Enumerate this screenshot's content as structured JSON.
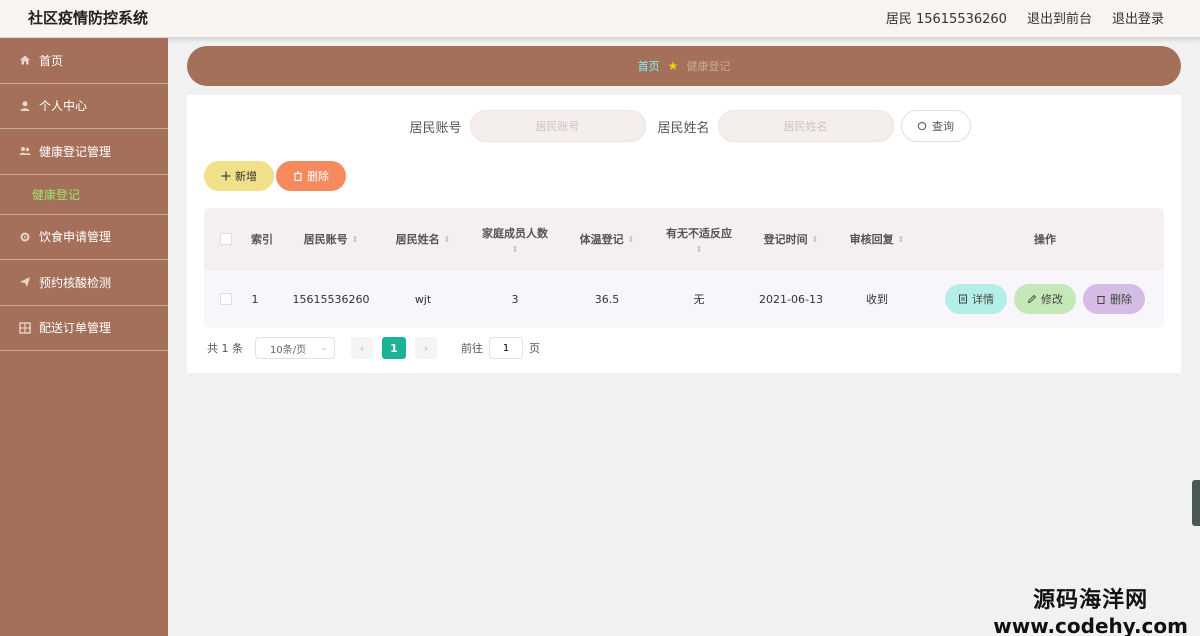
{
  "header": {
    "app_title": "社区疫情防控系统",
    "user": "居民 15615536260",
    "to_front": "退出到前台",
    "logout": "退出登录"
  },
  "sidebar": {
    "items": [
      {
        "label": "首页",
        "icon": "home-icon"
      },
      {
        "label": "个人中心",
        "icon": "user-icon"
      },
      {
        "label": "健康登记管理",
        "icon": "users-icon"
      },
      {
        "label": "饮食申请管理",
        "icon": "gear-icon"
      },
      {
        "label": "预约核酸检测",
        "icon": "send-icon"
      },
      {
        "label": "配送订单管理",
        "icon": "grid-icon"
      }
    ],
    "sub_item": "健康登记"
  },
  "breadcrumb": {
    "home": "首页",
    "current": "健康登记"
  },
  "search": {
    "account_label": "居民账号",
    "account_placeholder": "居民账号",
    "name_label": "居民姓名",
    "name_placeholder": "居民姓名",
    "query_label": "查询"
  },
  "actions": {
    "add_label": "新增",
    "delete_label": "删除"
  },
  "table": {
    "headers": {
      "index": "索引",
      "account": "居民账号",
      "name": "居民姓名",
      "family": "家庭成员人数",
      "temp": "体温登记",
      "symptom": "有无不适反应",
      "time": "登记时间",
      "review": "审核回复",
      "ops": "操作"
    },
    "rows": [
      {
        "index": "1",
        "account": "15615536260",
        "name": "wjt",
        "family": "3",
        "temp": "36.5",
        "symptom": "无",
        "time": "2021-06-13",
        "review": "收到",
        "detail": "详情",
        "edit": "修改",
        "remove": "删除"
      }
    ]
  },
  "pager": {
    "total": "共 1 条",
    "page_size": "10条/页",
    "current_page": "1",
    "goto_label": "前往",
    "goto_value": "1",
    "page_unit": "页",
    "prev": "‹",
    "next": "›"
  },
  "watermark": {
    "cn": "源码海洋网",
    "url": "www.codehy.com"
  },
  "colors": {
    "brand": "#a5705a",
    "page_active": "#1bb394",
    "sub_active": "#9ee36b"
  }
}
